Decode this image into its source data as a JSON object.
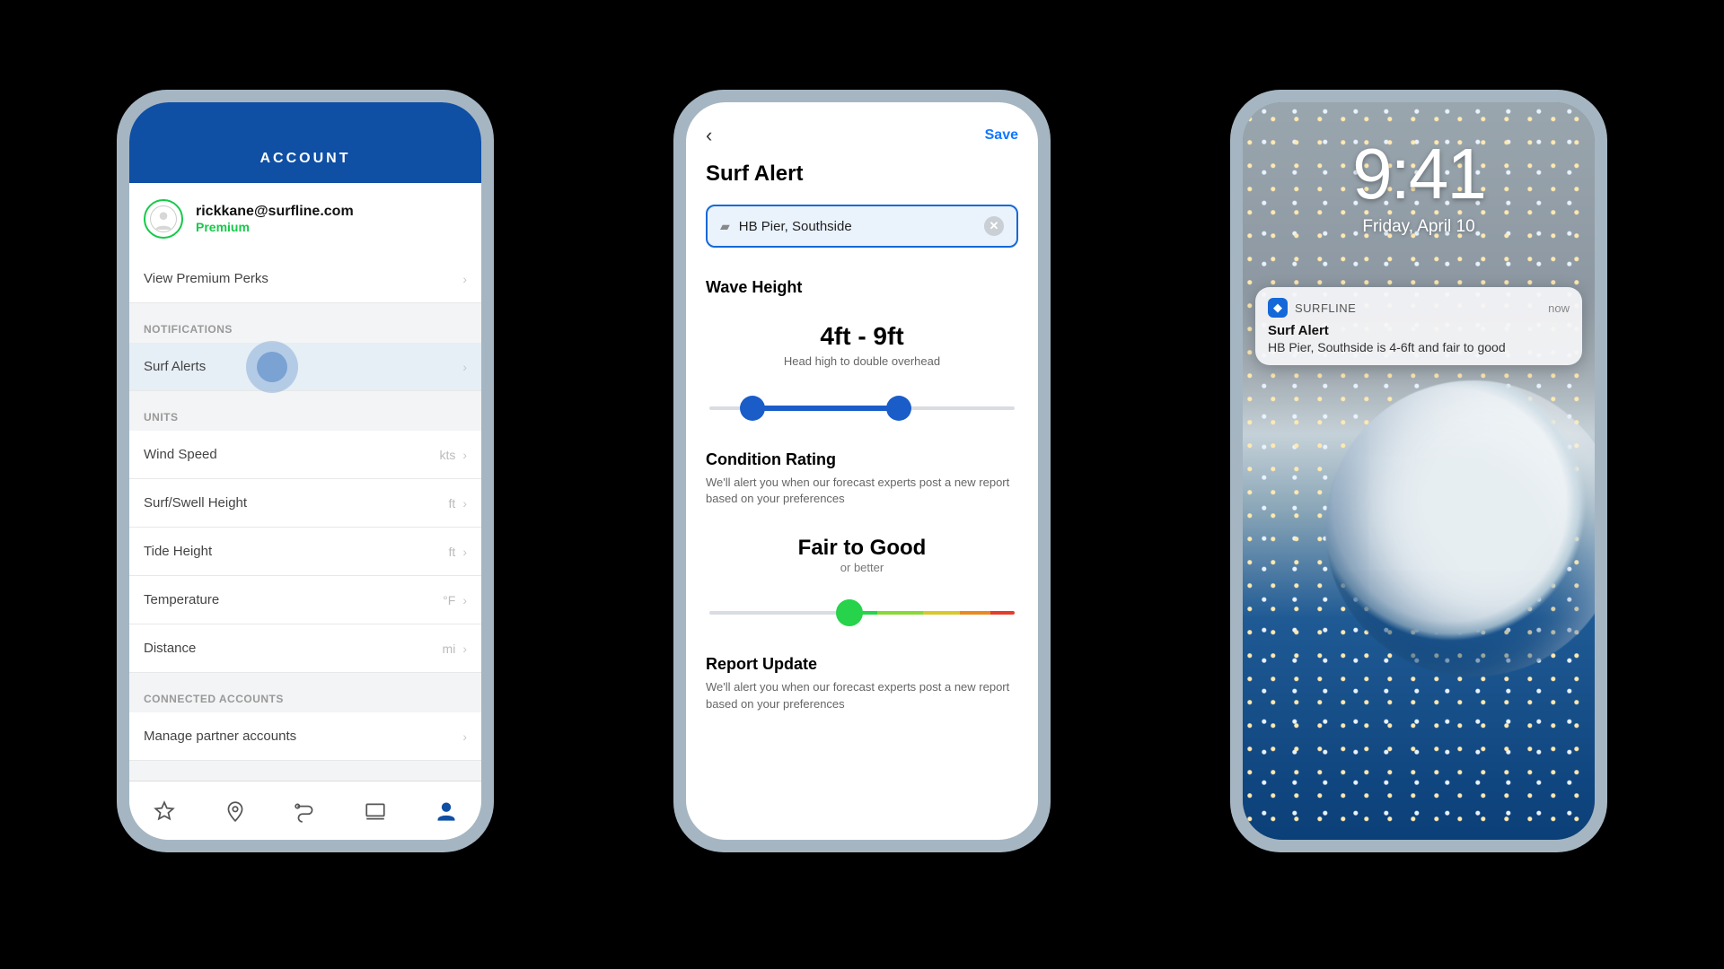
{
  "phone1": {
    "header": "ACCOUNT",
    "email": "rickkane@surfline.com",
    "tier": "Premium",
    "perks_row": "View Premium Perks",
    "sections": {
      "notifications_label": "NOTIFICATIONS",
      "surf_alerts": "Surf Alerts",
      "units_label": "UNITS",
      "wind": {
        "label": "Wind Speed",
        "unit": "kts"
      },
      "swell": {
        "label": "Surf/Swell Height",
        "unit": "ft"
      },
      "tide": {
        "label": "Tide Height",
        "unit": "ft"
      },
      "temp": {
        "label": "Temperature",
        "unit": "°F"
      },
      "dist": {
        "label": "Distance",
        "unit": "mi"
      },
      "connected_label": "CONNECTED ACCOUNTS",
      "partner": "Manage partner accounts"
    }
  },
  "phone2": {
    "save": "Save",
    "title": "Surf Alert",
    "spot": "HB Pier, Southside",
    "wave_h_label": "Wave Height",
    "wave_value": "4ft - 9ft",
    "wave_desc": "Head high to double overhead",
    "cond_label": "Condition Rating",
    "cond_sub": "We'll alert you when our forecast experts post a new report based on your preferences",
    "cond_value": "Fair to Good",
    "cond_value_sub": "or better",
    "report_label": "Report Update",
    "report_sub": "We'll alert you when our forecast experts post a new report based on your preferences",
    "slider": {
      "min_pct": 14,
      "max_pct": 62
    }
  },
  "phone3": {
    "time": "9:41",
    "date": "Friday, April 10",
    "app": "SURFLINE",
    "when": "now",
    "notif_title": "Surf Alert",
    "notif_body": "HB Pier, Southside is 4-6ft and fair to good"
  }
}
